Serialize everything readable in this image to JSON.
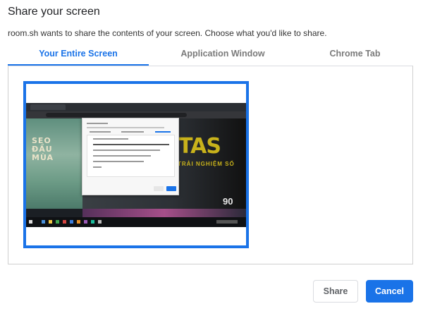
{
  "dialog": {
    "title": "Share your screen",
    "description": "room.sh wants to share the contents of your screen. Choose what you'd like to share."
  },
  "tabs": [
    {
      "label": "Your Entire Screen",
      "active": true
    },
    {
      "label": "Application Window",
      "active": false
    },
    {
      "label": "Chrome Tab",
      "active": false
    }
  ],
  "preview": {
    "wallpaper_text": "SEO ĐẦU MÙA",
    "logo_text": "TAS",
    "logo_subtitle": "TRẢI NGHIỆM SỐ",
    "number_text": "90"
  },
  "buttons": {
    "share_label": "Share",
    "cancel_label": "Cancel"
  },
  "colors": {
    "accent": "#1a73e8",
    "inactive_tab": "#7a7a7a",
    "logo": "#c8b21b"
  }
}
